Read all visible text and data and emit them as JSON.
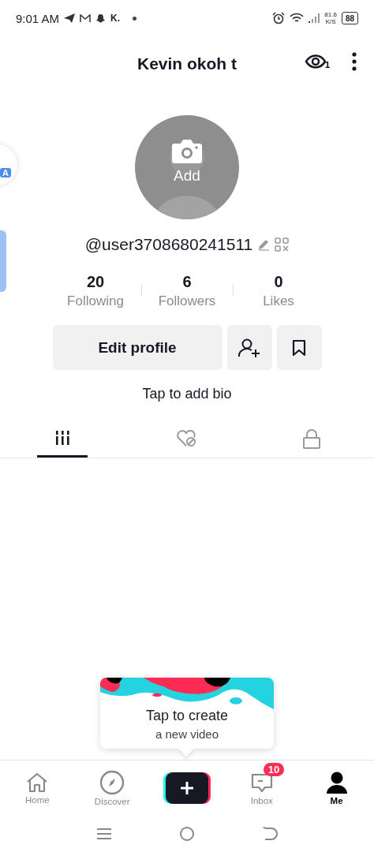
{
  "status_bar": {
    "time": "9:01 AM",
    "notification_text": "K.",
    "speed_value": "81.6",
    "speed_unit": "K/S",
    "battery": "88"
  },
  "side_widget": {
    "label": "A"
  },
  "header": {
    "title": "Kevin okoh t",
    "views_count": "1"
  },
  "profile": {
    "avatar_label": "Add",
    "username": "@user3708680241511"
  },
  "stats": [
    {
      "value": "20",
      "label": "Following"
    },
    {
      "value": "6",
      "label": "Followers"
    },
    {
      "value": "0",
      "label": "Likes"
    }
  ],
  "actions": {
    "edit_label": "Edit profile"
  },
  "bio": "Tap to add bio",
  "tabs": [
    {
      "kind": "videos",
      "selected": true
    },
    {
      "kind": "liked",
      "selected": false
    },
    {
      "kind": "private",
      "selected": false
    }
  ],
  "tooltip": {
    "title": "Tap to create",
    "subtitle": "a new video"
  },
  "bottom_nav": [
    {
      "kind": "home",
      "label": "Home",
      "selected": false
    },
    {
      "kind": "discover",
      "label": "Discover",
      "selected": false
    },
    {
      "kind": "create",
      "selected": false
    },
    {
      "kind": "inbox",
      "label": "Inbox",
      "badge": "10",
      "selected": false
    },
    {
      "kind": "me",
      "label": "Me",
      "selected": true
    }
  ]
}
